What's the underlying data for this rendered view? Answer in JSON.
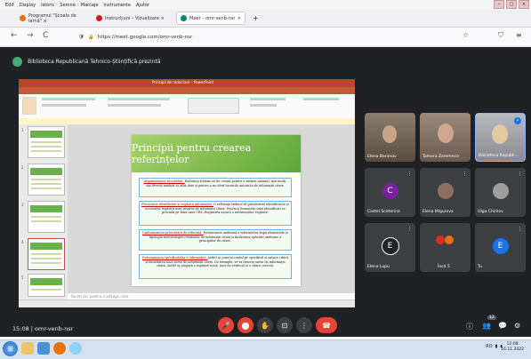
{
  "browser": {
    "menu": [
      "Edit",
      "Display",
      "Istoric",
      "Semne",
      "Marcaje",
      "Instrumente",
      "Ajutor"
    ],
    "tabs": [
      {
        "label": "Programul \"Școala de iarnă\" ×",
        "color": "#e8710a"
      },
      {
        "label": "Instrucțiuni – Vizualizare ×",
        "color": "#c5221f"
      },
      {
        "label": "Meet – omr-venb-nsr",
        "color": "#00897b"
      }
    ],
    "new_tab": "+",
    "url": "https://meet.google.com/omr-venb-nsr",
    "back": "←",
    "forward": "→",
    "reload": "C"
  },
  "meet": {
    "banner_title": "Biblioteca Republicană Tehnico-Științifică prezintă",
    "meeting_code": "15:08  |  omr-venb-nsr",
    "participants": [
      {
        "name": "Elena Baranov",
        "initial": "",
        "color": "",
        "type": "video1"
      },
      {
        "name": "Tamara Zaremnco",
        "initial": "",
        "color": "",
        "type": "video2"
      },
      {
        "name": "Biblioteca Republi...",
        "initial": "",
        "color": "",
        "type": "video3"
      },
      {
        "name": "Costel Sceterina",
        "initial": "C",
        "color": "#7b1fa2"
      },
      {
        "name": "Elena Migurova",
        "initial": "",
        "color": "#8d6e63"
      },
      {
        "name": "Olga Chirilov",
        "initial": "",
        "color": "#9e9e9e"
      },
      {
        "name": "Elena Lupu",
        "initial": "E",
        "color": "#1e8e3e"
      },
      {
        "name": "Încă 5",
        "initial": "",
        "color": "#d93025"
      },
      {
        "name": "Tu",
        "initial": "E",
        "color": "#1a73e8"
      }
    ],
    "controls": {
      "mic": "🎤",
      "cam": "⬤",
      "hand": "✋",
      "present": "⊡",
      "more": "⋮",
      "hangup": "☎"
    },
    "right_controls": {
      "info": "ⓘ",
      "people": "👥",
      "chat": "💬",
      "activities": "⚙",
      "badge": "12"
    }
  },
  "powerpoint": {
    "title_bar": "Principii de redactare – PowerPoint",
    "slide_title": "Principii pentru crearea referințelor",
    "bullets": [
      {
        "kw": "Argumentarea necesității. ",
        "text": "Referinţa trebuie să fie creată pentru a susține anumiți, mai mulți, sau diverși analiști să aibă date și pentru a nu oferi lucrările autorului de informații citate."
      },
      {
        "kw": "Precizarea identificării și regăsirii informației. ",
        "text": "O referinţă trebuie să prioritizeze identificarea și accesarea regăsirii unei resurse de informații citate. Practica formatării unei identificări se prezintă pe baza unei URL. Regăsirea ușoară a informațiilor regăsite."
      },
      {
        "kw": "Uniformizarea prezentării de referință. ",
        "text": "Prezentarea uniformă a referințelor după elementele și tipologia metodologiei resurselor de informații citate și facilitarea aplicării uniforme a principiilor de citare."
      },
      {
        "kw": "Determinarea specificațiilor a informației. ",
        "text": "Astfel se pune accentul pe specificul și natura citării și încadrarea unei surse de informații citate. De exemplu, se va descrie sursa de informaţie citată. Astfel se asigură o regăsire nouă, ușor de verificat și o citare corectă."
      }
    ],
    "notes": "Faceți clic pentru a adăuga note",
    "slide_numbers": [
      "1",
      "2",
      "3",
      "4",
      "5"
    ]
  },
  "taskbar": {
    "clock_time": "12:08",
    "clock_date": "16.11.2022",
    "lang": "RO"
  }
}
